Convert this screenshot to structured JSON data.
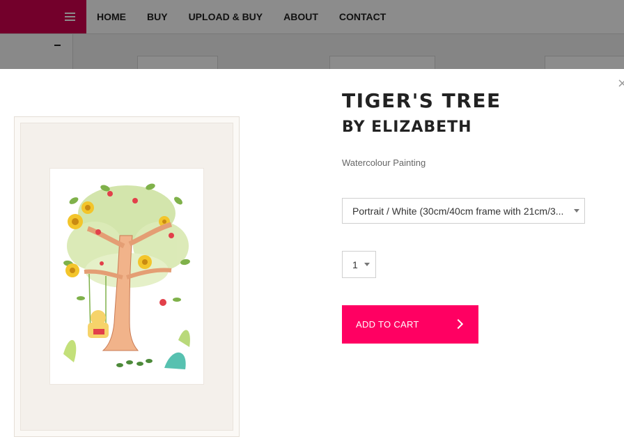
{
  "colors": {
    "brand": "#d1004f",
    "accent": "#ff0062",
    "text": "#222222"
  },
  "nav": {
    "items": [
      {
        "label": "HOME"
      },
      {
        "label": "BUY"
      },
      {
        "label": "UPLOAD & BUY"
      },
      {
        "label": "ABOUT"
      },
      {
        "label": "CONTACT"
      }
    ]
  },
  "icons": {
    "menu": "hamburger-icon",
    "collapse": "minus-icon",
    "close": "close-icon",
    "select_caret": "chevron-down-icon",
    "button_arrow": "chevron-right-icon"
  },
  "product": {
    "title": "TIGER'S TREE",
    "artist": "BY ELIZABETH",
    "medium": "Watercolour Painting",
    "option_selected": "Portrait / White (30cm/40cm frame with 21cm/3...",
    "quantity": "1",
    "add_to_cart": "ADD TO CART"
  }
}
